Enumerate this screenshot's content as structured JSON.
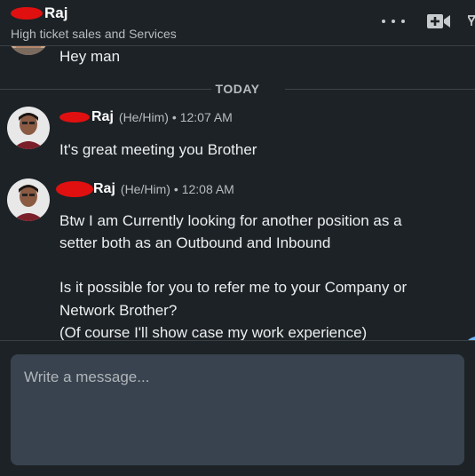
{
  "header": {
    "contact_name": "Raj",
    "headline": "High ticket sales and Services"
  },
  "conversation": {
    "previous_message": "Hey man",
    "date_divider": "TODAY",
    "messages": [
      {
        "sender": "Raj",
        "pronouns": "(He/Him)",
        "time": "• 12:07 AM",
        "lines": [
          "It's great meeting you Brother"
        ]
      },
      {
        "sender": "Raj",
        "pronouns": "(He/Him)",
        "time": "• 12:08 AM",
        "lines": [
          "Btw I am Currently looking for another position as a",
          "setter both as an Outbound and Inbound",
          "",
          "Is it possible for you to refer me to your Company or",
          "Network Brother?",
          "(Of course I'll show case my work experience)"
        ]
      }
    ]
  },
  "composer": {
    "placeholder": "Write a message..."
  },
  "icons": {
    "more": "more-horizontal-icon",
    "video": "video-call-icon",
    "compose": "compose-icon"
  },
  "colors": {
    "background": "#1d2226",
    "composer": "#38434f",
    "redaction": "#e01010",
    "accent": "#70b5f9"
  }
}
